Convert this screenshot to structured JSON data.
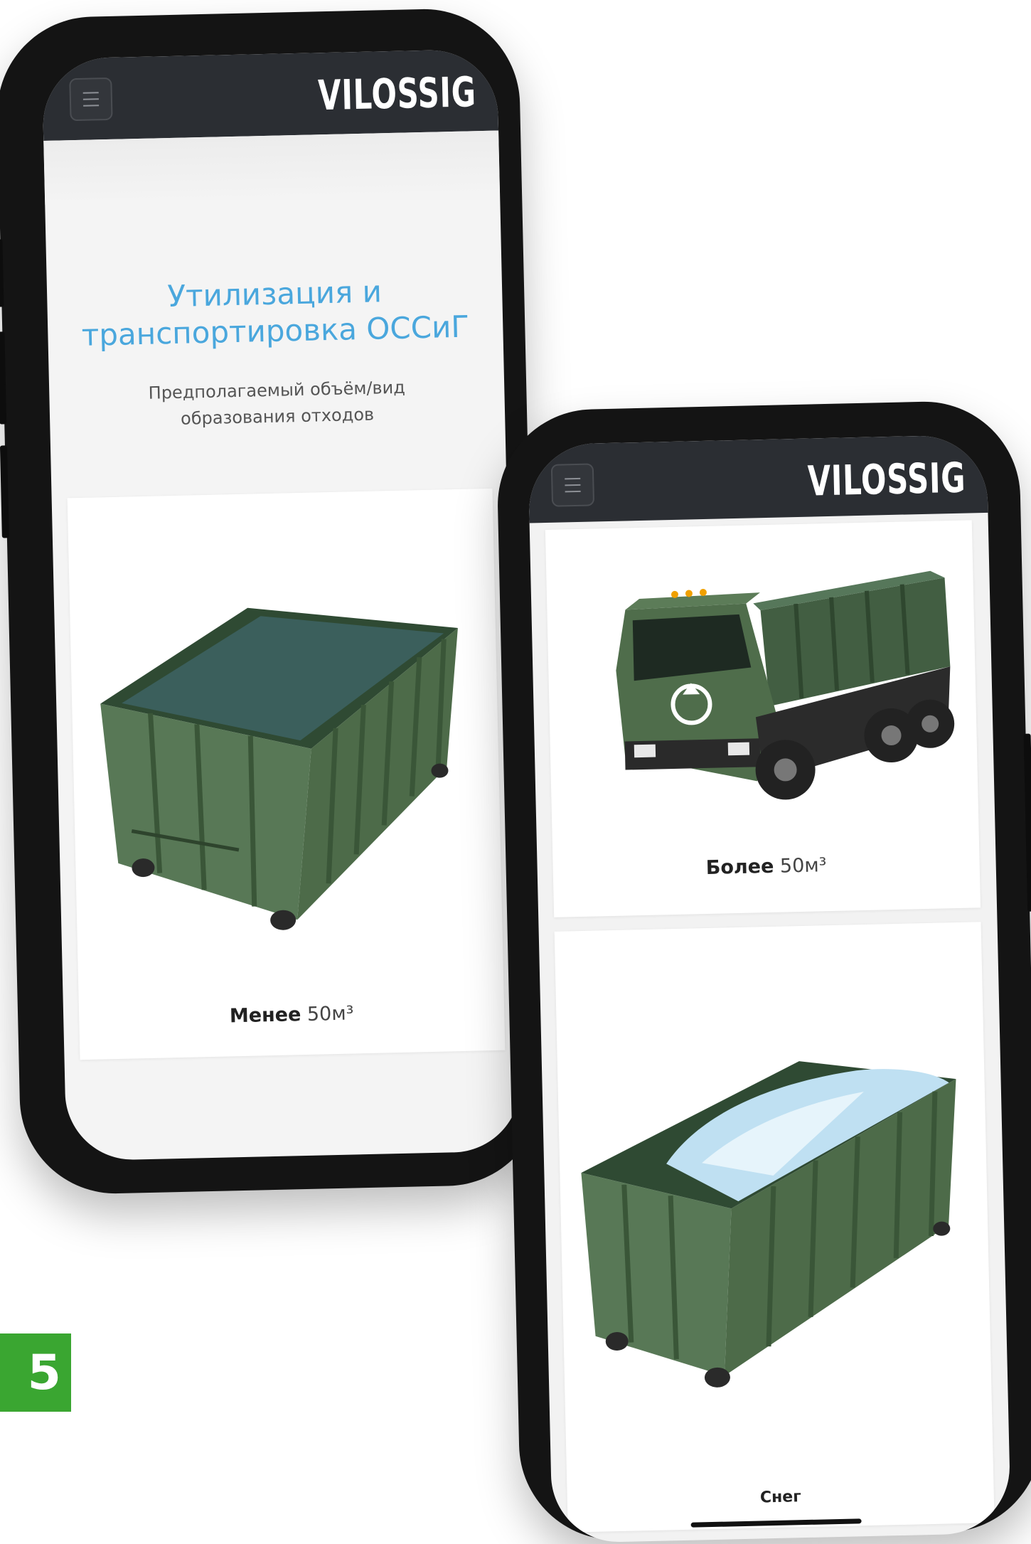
{
  "brand": {
    "logo_text": "VILOSSIG"
  },
  "screen1": {
    "title": "Утилизация и транспортировка ОССиГ",
    "subtitle": "Предполагаемый объём/вид образования отходов",
    "card": {
      "label_bold": "Менее",
      "label_rest": "50м³",
      "image": "green-roll-off-container"
    }
  },
  "screen2": {
    "cards": [
      {
        "label_bold": "Более",
        "label_rest": "50м³",
        "image": "green-dump-truck-recycling"
      },
      {
        "label_bold": "Снег",
        "label_rest": "",
        "image": "container-with-snow"
      }
    ]
  },
  "badge": {
    "text": "5"
  },
  "colors": {
    "appbar": "#2b2e33",
    "title_blue": "#4aa7dd",
    "badge_green": "#3aa631",
    "container_green": "#3e5a3a"
  }
}
